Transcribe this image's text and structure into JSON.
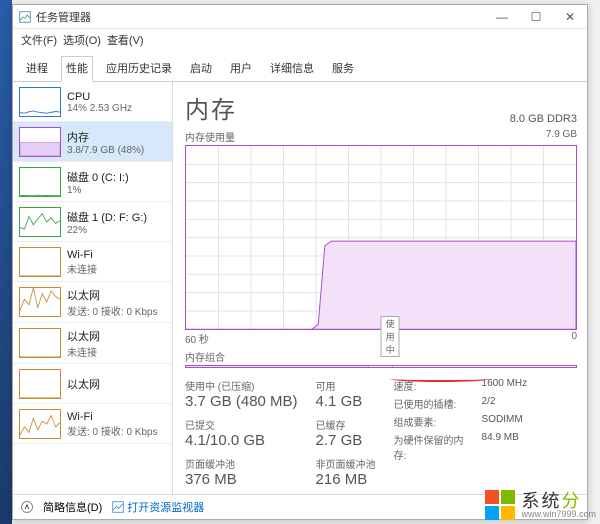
{
  "window": {
    "title": "任务管理器"
  },
  "menu": {
    "file": "文件(F)",
    "options": "选项(O)",
    "view": "查看(V)"
  },
  "tabs": {
    "items": [
      "进程",
      "性能",
      "应用历史记录",
      "启动",
      "用户",
      "详细信息",
      "服务"
    ],
    "active_index": 1
  },
  "sidebar": {
    "items": [
      {
        "name": "CPU",
        "sub": "14% 2.53 GHz",
        "color": "#2a7ad1",
        "spark": [
          12,
          10,
          15,
          18,
          14,
          12,
          10,
          13,
          16,
          14
        ]
      },
      {
        "name": "内存",
        "sub": "3.8/7.9 GB (48%)",
        "color": "#a64ecb",
        "selected": true,
        "spark_flat": 48
      },
      {
        "name": "磁盘 0 (C: I:)",
        "sub": "1%",
        "color": "#3aa04a",
        "spark": [
          1,
          2,
          1,
          1,
          3,
          1,
          2,
          1,
          1,
          1
        ]
      },
      {
        "name": "磁盘 1 (D: F: G:)",
        "sub": "22%",
        "color": "#3aa04a",
        "spark": [
          30,
          25,
          70,
          40,
          60,
          80,
          50,
          65,
          45,
          55
        ]
      },
      {
        "name": "Wi-Fi",
        "sub": "未连接",
        "color": "#c78a2e",
        "spark": [
          0,
          0,
          0,
          0,
          0,
          0,
          0,
          0,
          0,
          0
        ]
      },
      {
        "name": "以太网",
        "sub": "发送: 0 接收: 0 Kbps",
        "color": "#c78a2e",
        "spark": [
          20,
          60,
          40,
          100,
          30,
          80,
          50,
          90,
          70,
          60
        ]
      },
      {
        "name": "以太网",
        "sub": "未连接",
        "color": "#c78a2e",
        "spark": [
          0,
          0,
          0,
          0,
          0,
          0,
          0,
          0,
          0,
          0
        ]
      },
      {
        "name": "以太网",
        "sub": "",
        "color": "#c78a2e",
        "spark": [
          0,
          0,
          0,
          0,
          0,
          0,
          0,
          0,
          0,
          0
        ]
      },
      {
        "name": "Wi-Fi",
        "sub": "发送: 0 接收: 0 Kbps",
        "color": "#c78a2e",
        "spark": [
          10,
          40,
          20,
          70,
          30,
          60,
          50,
          80,
          40,
          55
        ]
      }
    ]
  },
  "main": {
    "title": "内存",
    "subtitle_right": "8.0 GB DDR3",
    "usage_label": "内存使用量",
    "usage_max": "7.9 GB",
    "axis_left": "60 秒",
    "axis_right": "0",
    "marker": "使用中",
    "composition_label": "内存组合"
  },
  "stats": {
    "in_use_label": "使用中 (已压缩)",
    "in_use": "3.7 GB (480 MB)",
    "available_label": "可用",
    "available": "4.1 GB",
    "committed_label": "已提交",
    "committed": "4.1/10.0 GB",
    "cached_label": "已缓存",
    "cached": "2.7 GB",
    "paged_label": "页面缓冲池",
    "paged": "376 MB",
    "nonpaged_label": "非页面缓冲池",
    "nonpaged": "216 MB",
    "speed_label": "速度:",
    "speed": "1600 MHz",
    "slots_label": "已使用的插槽:",
    "slots": "2/2",
    "formfactor_label": "组成要素:",
    "formfactor": "SODIMM",
    "reserved_label": "为硬件保留的内存:",
    "reserved": "84.9 MB"
  },
  "footer": {
    "simple_view": "简略信息(D)",
    "open_resmon": "打开资源监视器"
  },
  "watermark": {
    "brand": "系统",
    "brand_accent": "分",
    "url": "www.win7999.com"
  },
  "chart_data": {
    "type": "area",
    "title": "内存使用量",
    "ylabel": "GB",
    "ylim": [
      0,
      7.9
    ],
    "x_window_seconds": 60,
    "series": [
      {
        "name": "使用中",
        "values": [
          0,
          0,
          0,
          0,
          0,
          0,
          0,
          0,
          0,
          0,
          0,
          0,
          0,
          0,
          0,
          0,
          0,
          0,
          0,
          0,
          0.2,
          3.6,
          3.8,
          3.8,
          3.8,
          3.8,
          3.8,
          3.8,
          3.8,
          3.8,
          3.8,
          3.8,
          3.8,
          3.8,
          3.8,
          3.8,
          3.8,
          3.8,
          3.8,
          3.8,
          3.8,
          3.8,
          3.8,
          3.8,
          3.8,
          3.8,
          3.8,
          3.8,
          3.8,
          3.8,
          3.8,
          3.8,
          3.8,
          3.8,
          3.8,
          3.8,
          3.8,
          3.8,
          3.8,
          3.8
        ]
      }
    ]
  }
}
